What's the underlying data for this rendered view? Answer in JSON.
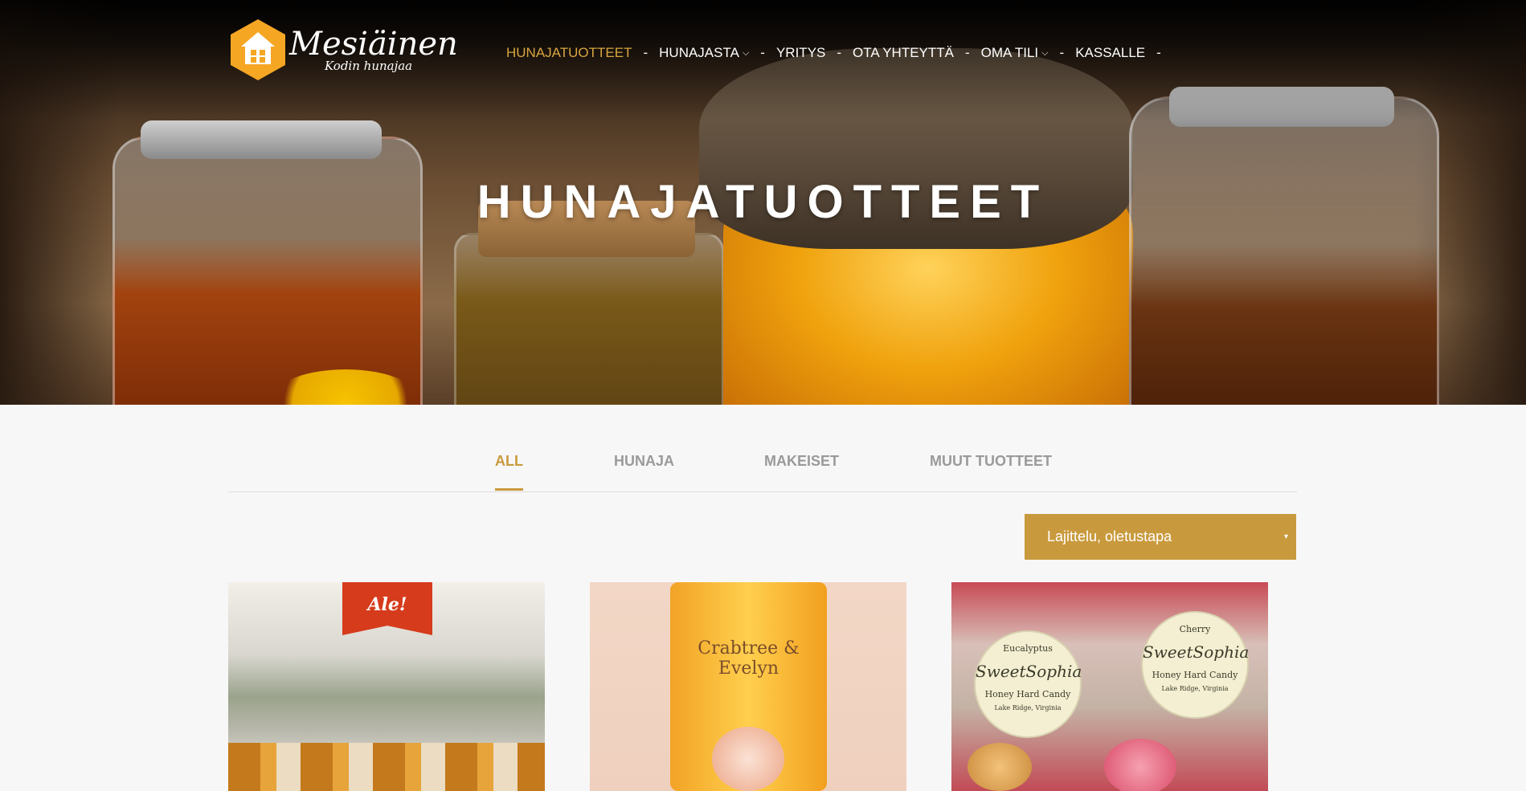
{
  "logo": {
    "name": "Mesiäinen",
    "tagline": "Kodin hunajaa"
  },
  "nav": {
    "items": [
      {
        "label": "HUNAJATUOTTEET",
        "active": true,
        "dropdown": false
      },
      {
        "label": "HUNAJASTA",
        "active": false,
        "dropdown": true
      },
      {
        "label": "YRITYS",
        "active": false,
        "dropdown": false
      },
      {
        "label": "OTA YHTEYTTÄ",
        "active": false,
        "dropdown": false
      },
      {
        "label": "OMA TILI",
        "active": false,
        "dropdown": true
      },
      {
        "label": "KASSALLE",
        "active": false,
        "dropdown": false
      }
    ],
    "separator": "-"
  },
  "hero": {
    "title": "HUNAJATUOTTEET"
  },
  "tabs": [
    {
      "label": "ALL",
      "active": true
    },
    {
      "label": "HUNAJA",
      "active": false
    },
    {
      "label": "MAKEISET",
      "active": false
    },
    {
      "label": "MUUT TUOTTEET",
      "active": false
    }
  ],
  "sort": {
    "label": "Lajittelu, oletustapa"
  },
  "products": {
    "sale_badge": "Ale!",
    "card2_brand": "Crabtree & Evelyn",
    "card3_stickers": [
      {
        "flavor": "Eucalyptus",
        "brand": "SweetSophia",
        "product": "Honey Hard Candy",
        "location": "Lake Ridge, Virginia"
      },
      {
        "flavor": "Cherry",
        "brand": "SweetSophia",
        "product": "Honey Hard Candy",
        "location": "Lake Ridge, Virginia"
      }
    ]
  },
  "colors": {
    "accent": "#c99a3d",
    "nav_active": "#d8a640",
    "sale_red": "#d63b1c",
    "background": "#f7f7f7"
  }
}
